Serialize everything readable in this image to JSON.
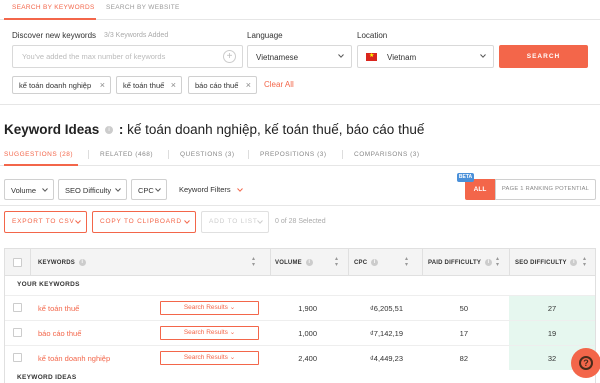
{
  "topnav": {
    "tabs": [
      {
        "label": "SEARCH BY KEYWORDS",
        "active": true
      },
      {
        "label": "SEARCH BY WEBSITE",
        "active": false
      }
    ]
  },
  "search": {
    "discover_label": "Discover new keywords",
    "keywords_added": "3/3 Keywords Added",
    "placeholder": "You've added the max number of keywords",
    "language_label": "Language",
    "language_value": "Vietnamese",
    "location_label": "Location",
    "location_value": "Vietnam",
    "search_button": "SEARCH",
    "chips": [
      "kế toán doanh nghiệp",
      "kế toán thuế",
      "báo cáo thuế"
    ],
    "clear_all": "Clear All"
  },
  "ideas": {
    "title": "Keyword Ideas",
    "separator": ":",
    "query": "kế toán doanh nghiệp, kế toán thuế, báo cáo thuế"
  },
  "subtabs": [
    {
      "label": "SUGGESTIONS (28)",
      "active": true
    },
    {
      "label": "RELATED (468)",
      "active": false
    },
    {
      "label": "QUESTIONS (3)",
      "active": false
    },
    {
      "label": "PREPOSITIONS (3)",
      "active": false
    },
    {
      "label": "COMPARISONS (3)",
      "active": false
    }
  ],
  "filters": {
    "volume": "Volume",
    "seo_difficulty": "SEO Difficulty",
    "cpc": "CPC",
    "keyword_filters": "Keyword Filters",
    "beta": "BETA",
    "all": "ALL",
    "page1": "PAGE 1 RANKING POTENTIAL"
  },
  "actions": {
    "export": "EXPORT TO CSV",
    "copy": "COPY TO CLIPBOARD",
    "add_to_list": "ADD TO LIST",
    "selected": "0 of 28 Selected"
  },
  "table": {
    "headers": {
      "keywords": "KEYWORDS",
      "volume": "VOLUME",
      "cpc": "CPC",
      "paid_difficulty": "PAID DIFFICULTY",
      "seo_difficulty": "SEO DIFFICULTY"
    },
    "group_your": "YOUR KEYWORDS",
    "group_ideas": "KEYWORD IDEAS",
    "rows": [
      {
        "keyword": "kế toán thuế",
        "search_results": "Search Results",
        "volume": "1,900",
        "cpc": "₫6,205,51",
        "paid": "50",
        "seo": "27"
      },
      {
        "keyword": "báo cáo thuế",
        "search_results": "Search Results",
        "volume": "1,000",
        "cpc": "₫7,142,19",
        "paid": "17",
        "seo": "19"
      },
      {
        "keyword": "kế toán doanh nghiệp",
        "search_results": "Search Results",
        "volume": "2,400",
        "cpc": "₫4,449,23",
        "paid": "82",
        "seo": "32"
      }
    ]
  },
  "help": {
    "label": "?"
  },
  "colors": {
    "accent": "#f3664a",
    "beta": "#4a90d9",
    "seo_cell": "#e6f7ef"
  }
}
